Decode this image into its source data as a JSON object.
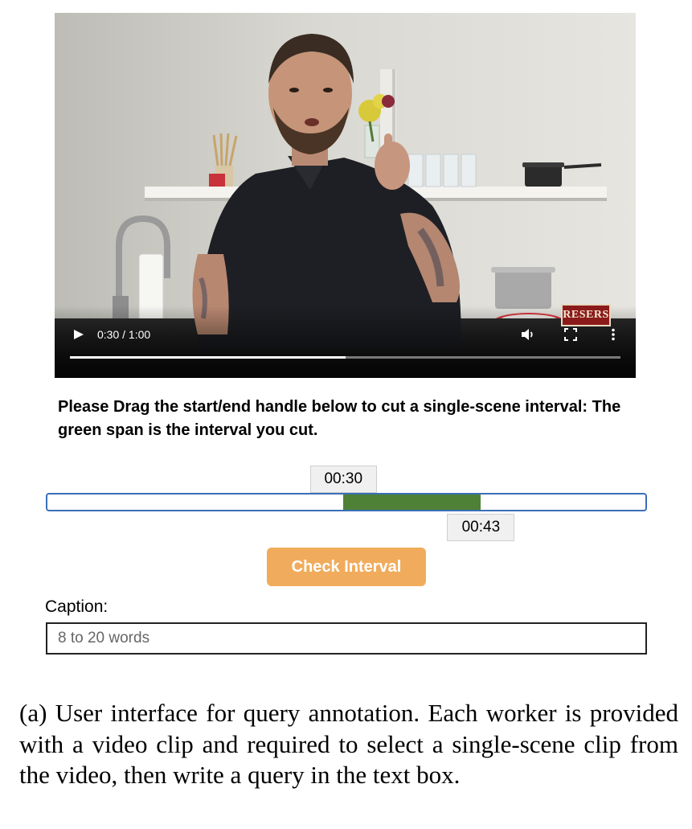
{
  "video": {
    "time_display": "0:30 / 1:00",
    "progress_fraction": 0.5,
    "brand_logo_text": "RESERS",
    "icons": {
      "play": "play-icon",
      "volume": "volume-icon",
      "fullscreen": "fullscreen-icon",
      "more": "more-options-icon"
    }
  },
  "instructions": "Please Drag the start/end handle below to cut a single-scene interval: The green span is the interval you cut.",
  "interval": {
    "start_label": "00:30",
    "end_label": "00:43",
    "start_fraction": 0.495,
    "end_fraction": 0.725,
    "span_color": "#4e8136",
    "track_border_color": "#3a6fb7"
  },
  "check_button": {
    "label": "Check Interval",
    "color": "#f0ac5c"
  },
  "caption": {
    "label": "Caption:",
    "placeholder": "8 to 20 words",
    "value": ""
  },
  "figure_caption": "(a) User interface for query annotation. Each worker is provided with a video clip and required to select a single-scene clip from the video, then write a query in the text box."
}
